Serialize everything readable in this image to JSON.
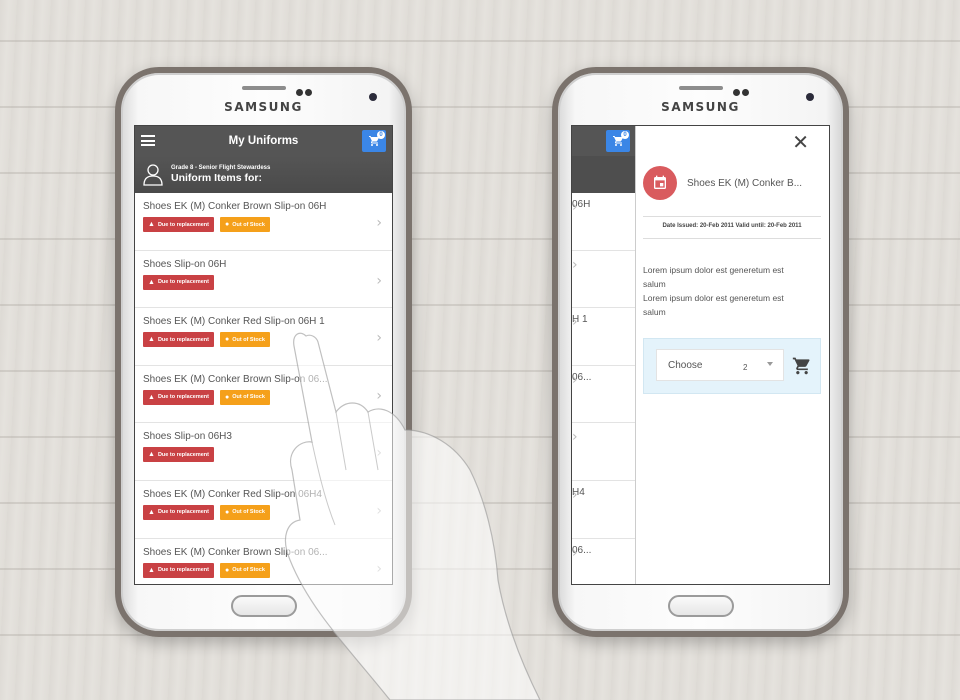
{
  "phone_left": {
    "brand": "SAMSUNG",
    "appbar": {
      "title": "My Uniforms",
      "cart_count": "0"
    },
    "user": {
      "grade": "Grade 8 - Senior Flight Stewardess",
      "heading": "Uniform Items for:"
    },
    "items": [
      {
        "name": "Shoes EK (M) Conker Brown Slip-on 06H",
        "badges": [
          "Due to replacement",
          "Out of Stock"
        ]
      },
      {
        "name": "Shoes Slip-on 06H",
        "badges": [
          "Due to replacement"
        ]
      },
      {
        "name": "Shoes EK (M) Conker Red Slip-on 06H 1",
        "badges": [
          "Due to replacement",
          "Out of Stock"
        ]
      },
      {
        "name": "Shoes EK (M) Conker Brown Slip-on 06...",
        "badges": [
          "Due to replacement",
          "Out of Stock"
        ]
      },
      {
        "name": "Shoes Slip-on 06H3",
        "badges": [
          "Due to replacement"
        ]
      },
      {
        "name": "Shoes EK (M) Conker Red Slip-on 06H4",
        "badges": [
          "Due to replacement",
          "Out of Stock"
        ]
      },
      {
        "name": "Shoes EK (M) Conker Brown Slip-on 06...",
        "badges": [
          "Due to replacement",
          "Out of Stock"
        ]
      }
    ]
  },
  "phone_right": {
    "brand": "SAMSUNG",
    "cart_count": "0",
    "background_rows": [
      "06H",
      "",
      "H 1",
      "06...",
      "",
      "H4",
      "06..."
    ],
    "drawer": {
      "title": "Shoes EK (M) Conker B...",
      "dates": "Date Issued: 20-Feb 2011  Valid until: 20-Feb 2011",
      "description_lines": [
        "Lorem ipsum dolor est generetum est",
        "salum",
        "Lorem ipsum dolor est generetum est",
        "salum"
      ],
      "select_label": "Choose",
      "quantity": "2"
    }
  },
  "colors": {
    "appbar": "#555555",
    "cart_button": "#3b86e6",
    "badge_due": "#c94144",
    "badge_stock": "#f5a01a",
    "avatar": "#d95b5e",
    "order_panel": "#e4f3fb"
  }
}
